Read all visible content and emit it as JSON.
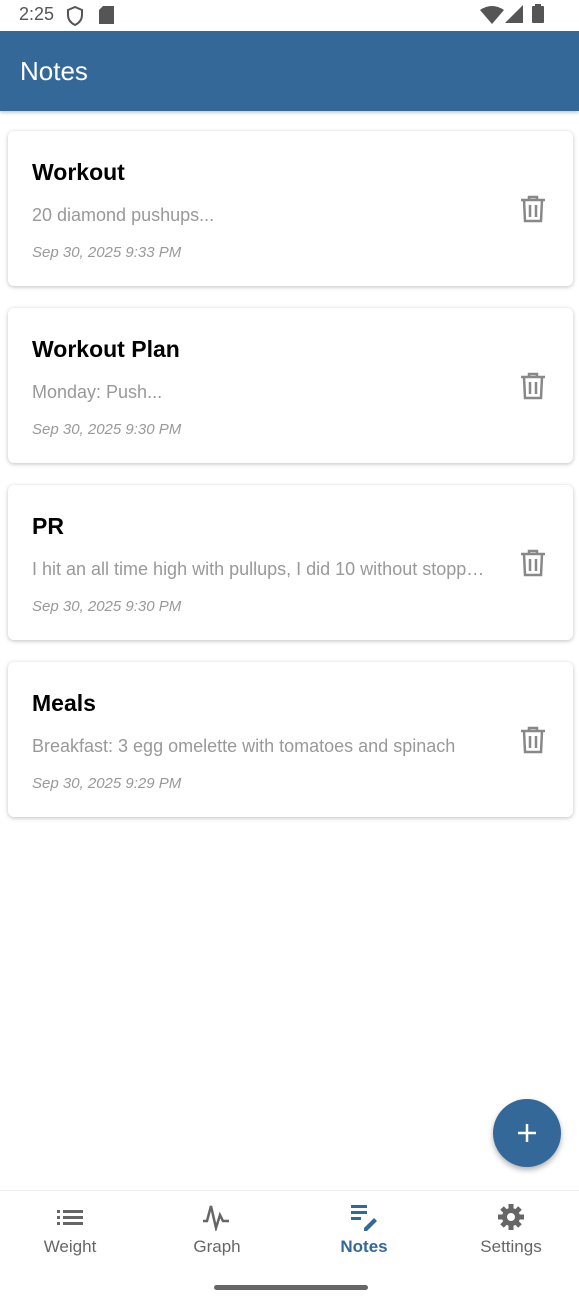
{
  "status": {
    "time": "2:25"
  },
  "header": {
    "title": "Notes"
  },
  "notes": [
    {
      "title": "Workout",
      "preview": "20 diamond pushups...",
      "date": "Sep 30, 2025 9:33 PM"
    },
    {
      "title": "Workout Plan",
      "preview": "Monday: Push...",
      "date": "Sep 30, 2025 9:30 PM"
    },
    {
      "title": "PR",
      "preview": "I hit an all time high with pullups, I did 10 without stopping",
      "date": "Sep 30, 2025 9:30 PM"
    },
    {
      "title": "Meals",
      "preview": "Breakfast: 3 egg omelette with tomatoes and spinach",
      "date": "Sep 30, 2025 9:29 PM"
    }
  ],
  "nav": [
    {
      "label": "Weight"
    },
    {
      "label": "Graph"
    },
    {
      "label": "Notes",
      "active": true
    },
    {
      "label": "Settings"
    }
  ],
  "colors": {
    "primary": "#336899"
  }
}
